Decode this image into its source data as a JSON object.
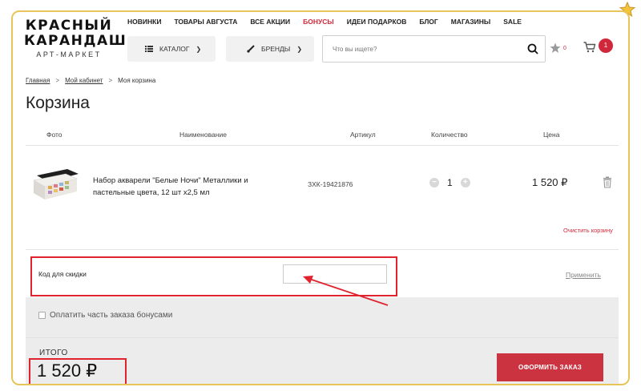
{
  "brand": {
    "line1": "КРАСНЫЙ",
    "line2": "КАРАНДАШ",
    "line3": "АРТ-МАРКЕТ"
  },
  "topnav": [
    {
      "label": "НОВИНКИ",
      "accent": false
    },
    {
      "label": "ТОВАРЫ АВГУСТА",
      "accent": false
    },
    {
      "label": "ВСЕ АКЦИИ",
      "accent": false
    },
    {
      "label": "БОНУСЫ",
      "accent": true
    },
    {
      "label": "ИДЕИ ПОДАРКОВ",
      "accent": false
    },
    {
      "label": "БЛОГ",
      "accent": false
    },
    {
      "label": "МАГАЗИНЫ",
      "accent": false
    },
    {
      "label": "SALE",
      "accent": false
    }
  ],
  "header": {
    "catalog_label": "КАТАЛОГ",
    "brands_label": "БРЕНДЫ",
    "search_placeholder": "Что вы ищете?",
    "favorites_count": "0",
    "cart_count": "1"
  },
  "breadcrumb": [
    "Главная",
    "Мой кабинет",
    "Моя корзина"
  ],
  "page_title": "Корзина",
  "table": {
    "columns": [
      "Фото",
      "Наименование",
      "Артикул",
      "Количество",
      "Цена"
    ],
    "rows": [
      {
        "name": "Набор акварели \"Белые Ночи\" Металлики и пастельные цвета, 12 шт х2,5 мл",
        "sku": "ЗХК-19421876",
        "qty": "1",
        "price": "1 520 ₽"
      }
    ]
  },
  "clear_cart_label": "Очистить корзину",
  "promo": {
    "label": "Код для скидки",
    "value": "",
    "apply_label": "Применить"
  },
  "bonus": {
    "label": "Оплатить часть заказа бонусами"
  },
  "total": {
    "label": "ИТОГО",
    "value": "1 520 ₽"
  },
  "checkout_label": "ОФОРМИТЬ ЗАКАЗ",
  "colors": {
    "accent": "#d0283a",
    "highlight": "#e0242f",
    "frame": "#e8c55a",
    "band": "#ececec"
  }
}
